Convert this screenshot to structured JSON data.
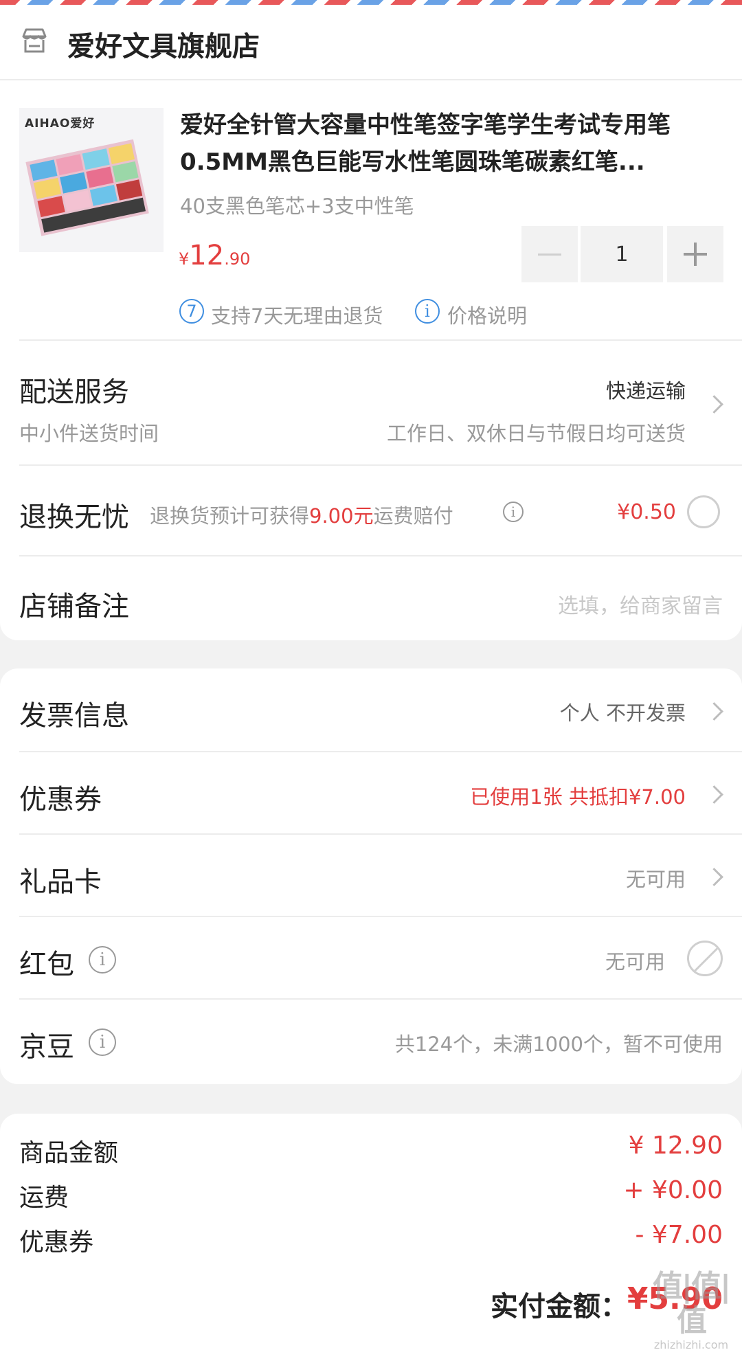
{
  "store": {
    "name": "爱好文具旗舰店"
  },
  "product": {
    "image_brand": "AIHAO爱好",
    "title": "爱好全针管大容量中性笔签字笔学生考试专用笔0.5MM黑色巨能写水性笔圆珠笔碳素红笔...",
    "spec": "40支黑色笔芯+3支中性笔",
    "price_symbol": "¥",
    "price_int": "12",
    "price_dec": ".90",
    "quantity": "1",
    "return_badge": "7",
    "return_text": "支持7天无理由退货",
    "price_note": "价格说明"
  },
  "delivery": {
    "label": "配送服务",
    "method": "快递运输",
    "time_label": "中小件送货时间",
    "time_value": "工作日、双休日与节假日均可送货"
  },
  "return_insurance": {
    "label": "退换无忧",
    "desc_prefix": "退换货预计可获得",
    "desc_amount": "9.00元",
    "desc_suffix": "运费赔付",
    "price": "¥0.50"
  },
  "store_note": {
    "label": "店铺备注",
    "placeholder": "选填，给商家留言"
  },
  "invoice": {
    "label": "发票信息",
    "value": "个人 不开发票"
  },
  "coupon": {
    "label": "优惠券",
    "value": "已使用1张 共抵扣¥7.00"
  },
  "gift_card": {
    "label": "礼品卡",
    "value": "无可用"
  },
  "red_packet": {
    "label": "红包",
    "value": "无可用"
  },
  "jd_beans": {
    "label": "京豆",
    "value": "共124个，未满1000个，暂不可使用"
  },
  "summary": {
    "goods_label": "商品金额",
    "goods_value": "¥ 12.90",
    "shipping_label": "运费",
    "shipping_value": "+ ¥0.00",
    "coupon_label": "优惠券",
    "coupon_value": "- ¥7.00",
    "pay_label": "实付金额：",
    "pay_value": "¥5.90"
  },
  "watermark": {
    "top": "值|值|值",
    "bottom": "zhizhizhi.com"
  },
  "colors": {
    "accent_red": "#e33e3e",
    "badge_blue": "#3f8ee0"
  }
}
